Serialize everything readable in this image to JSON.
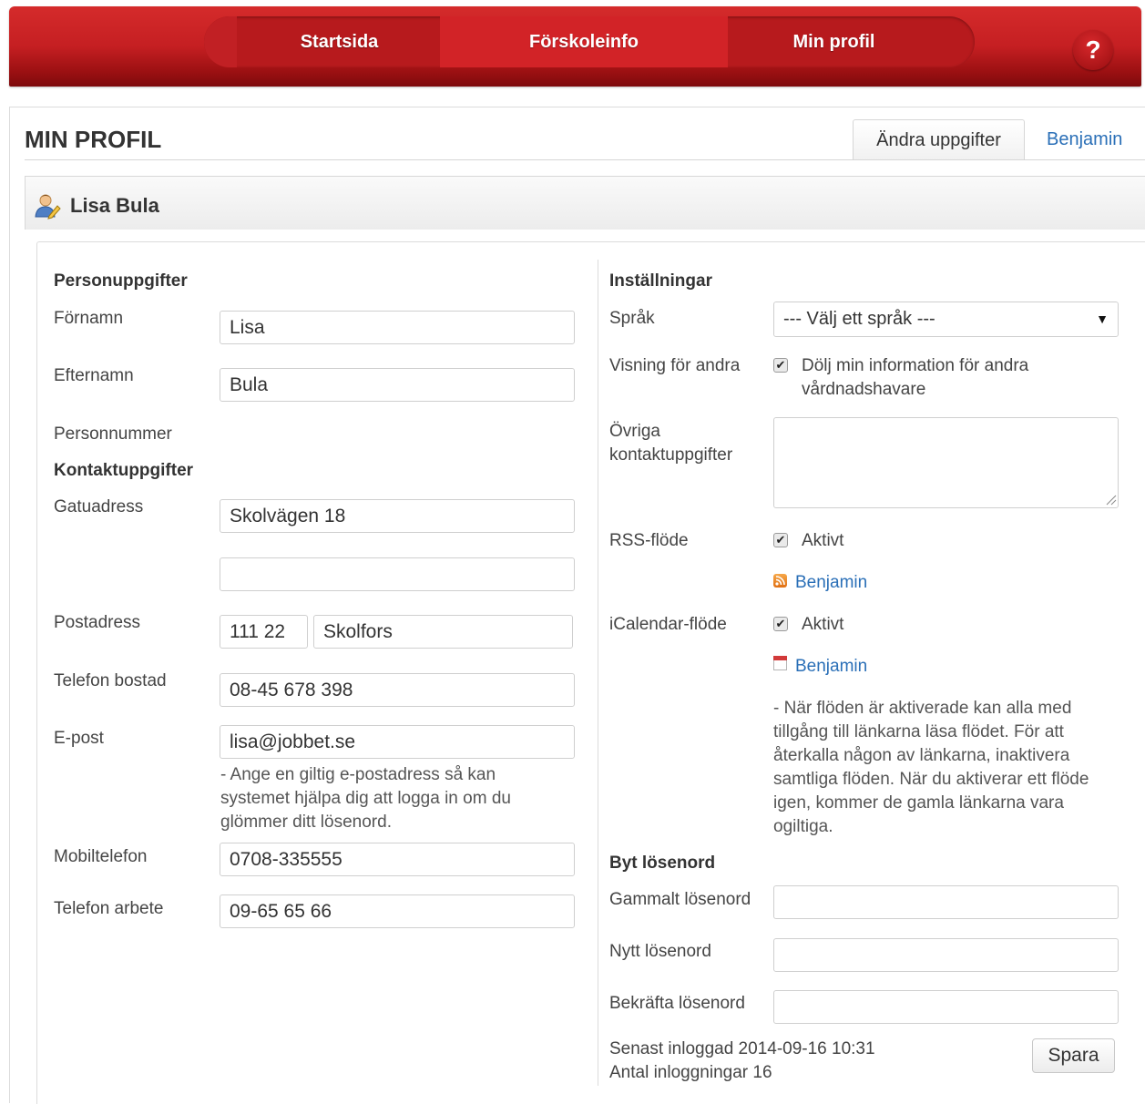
{
  "nav": {
    "items": [
      "Startsida",
      "Förskoleinfo",
      "Min profil"
    ],
    "help_label": "?"
  },
  "page": {
    "title": "MIN PROFIL",
    "tabs": [
      "Ändra uppgifter",
      "Benjamin"
    ]
  },
  "profile": {
    "name": "Lisa Bula",
    "icon": "user-edit-icon"
  },
  "personal": {
    "heading": "Personuppgifter",
    "firstname_label": "Förnamn",
    "firstname_value": "Lisa",
    "lastname_label": "Efternamn",
    "lastname_value": "Bula",
    "personnummer_label": "Personnummer"
  },
  "contact": {
    "heading": "Kontaktuppgifter",
    "street_label": "Gatuadress",
    "street_value": "Skolvägen 18",
    "street2_value": "",
    "postal_label": "Postadress",
    "postal_code_value": "111 22",
    "city_value": "Skolfors",
    "home_phone_label": "Telefon bostad",
    "home_phone_value": "08-45 678 398",
    "email_label": "E-post",
    "email_value": "lisa@jobbet.se",
    "email_hint": "- Ange en giltig e-postadress så kan systemet hjälpa dig att logga in om du glömmer ditt lösenord.",
    "mobile_label": "Mobiltelefon",
    "mobile_value": "0708-335555",
    "work_phone_label": "Telefon arbete",
    "work_phone_value": "09-65 65 66"
  },
  "settings": {
    "heading": "Inställningar",
    "language_label": "Språk",
    "language_selected": "--- Välj ett språk ---",
    "visibility_label": "Visning för andra",
    "visibility_checkbox_label": "Dölj min information för andra vårdnadshavare",
    "visibility_checked": true,
    "other_contact_label": "Övriga kontaktuppgifter",
    "other_contact_value": "",
    "rss_label": "RSS-flöde",
    "rss_checkbox_label": "Aktivt",
    "rss_checked": true,
    "rss_link": "Benjamin",
    "ical_label": "iCalendar-flöde",
    "ical_checkbox_label": "Aktivt",
    "ical_checked": true,
    "ical_link": "Benjamin",
    "feed_note": "- När flöden är aktiverade kan alla med tillgång till länkarna läsa flödet. För att återkalla någon av länkarna, inaktivera samtliga flöden. När du aktiverar ett flöde igen, kommer de gamla länkarna vara ogiltiga."
  },
  "password": {
    "heading": "Byt lösenord",
    "old_label": "Gammalt lösenord",
    "new_label": "Nytt lösenord",
    "confirm_label": "Bekräfta lösenord"
  },
  "footer": {
    "last_login": "Senast inloggad 2014-09-16 10:31",
    "login_count": "Antal inloggningar 16",
    "save_label": "Spara"
  },
  "colors": {
    "nav_red": "#c51f22",
    "link_blue": "#2a6fb7"
  }
}
